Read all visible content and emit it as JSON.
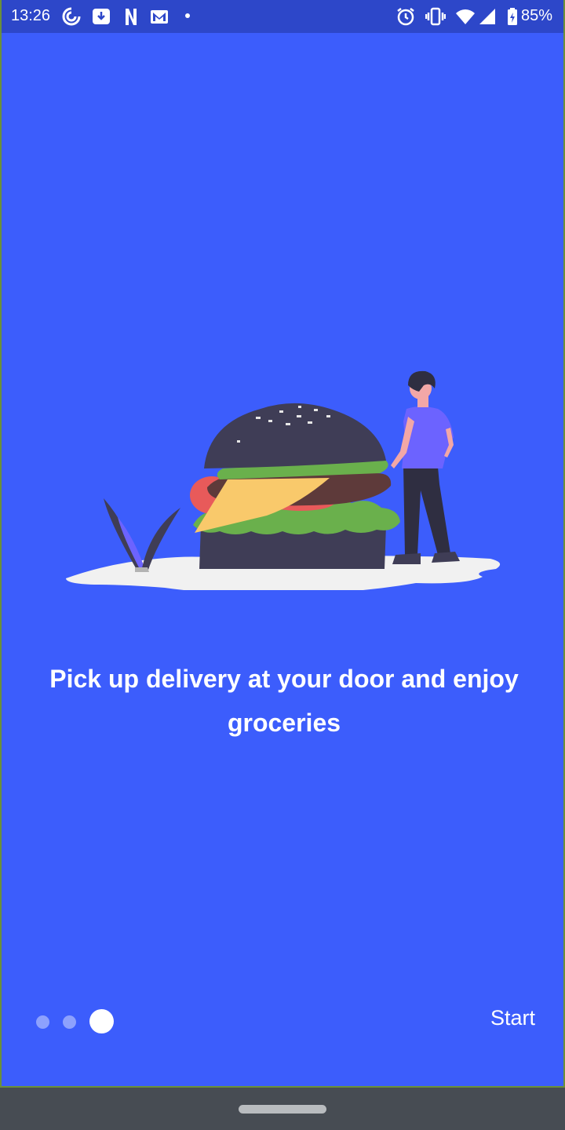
{
  "status_bar": {
    "time": "13:26",
    "battery_percent": "85%",
    "icons": [
      "sync-icon",
      "download-icon",
      "netflix-icon",
      "gmail-icon",
      "dot-icon",
      "alarm-icon",
      "vibrate-icon",
      "wifi-icon",
      "signal-icon",
      "battery-icon"
    ]
  },
  "onboarding": {
    "headline": "Pick up delivery at your door and enjoy groceries",
    "illustration": "burger-person-illustration",
    "page_indicator": {
      "total": 3,
      "current": 3
    },
    "start_label": "Start"
  },
  "colors": {
    "background": "#3c5dfc",
    "status_bar": "#2d47c9",
    "nav_bar": "#474c53",
    "text": "#ffffff",
    "dot_inactive": "#8da1fd",
    "dot_active": "#ffffff"
  }
}
